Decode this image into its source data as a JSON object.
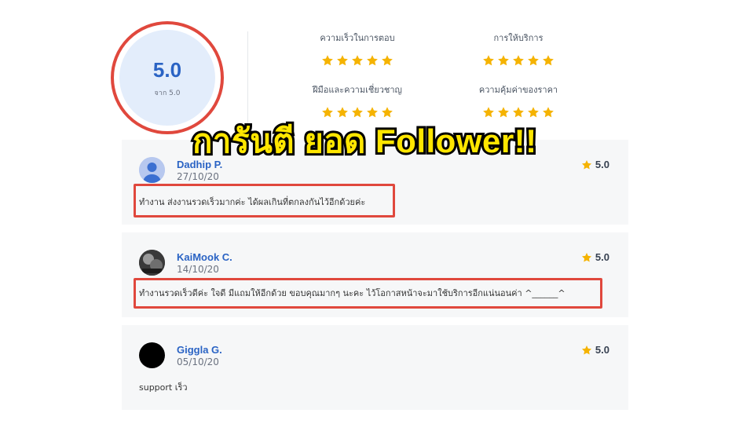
{
  "summary": {
    "score": "5.0",
    "score_caption": "จาก 5.0"
  },
  "categories": [
    {
      "label": "ความเร็วในการตอบ",
      "stars": 5
    },
    {
      "label": "การให้บริการ",
      "stars": 5
    },
    {
      "label": "ฝีมือและความเชี่ยวชาญ",
      "stars": 5
    },
    {
      "label": "ความคุ้มค่าของราคา",
      "stars": 5
    }
  ],
  "headline": "การันตี ยอด Follower!!",
  "reviews": [
    {
      "name": "Dadhip P.",
      "date": "27/10/20",
      "rating": "5.0",
      "text": "ทำงาน ส่งงานรวดเร็วมากค่ะ ได้ผลเกินที่ตกลงกันไว้อีกด้วยค่ะ",
      "avatar": "person-avatar"
    },
    {
      "name": "KaiMook C.",
      "date": "14/10/20",
      "rating": "5.0",
      "text": "ทำงานรวดเร็วดีค่ะ ใจดี มีแถมให้อีกด้วย ขอบคุณมากๆ นะคะ ไว้โอกาสหน้าจะมาใช้บริการอีกแน่นอนค่า ^______^",
      "avatar": "photo-avatar"
    },
    {
      "name": "Giggla G.",
      "date": "05/10/20",
      "rating": "5.0",
      "text": "support เร็ว",
      "avatar": "black-avatar"
    }
  ],
  "colors": {
    "accent": "#2a63c4",
    "star": "#f5b301",
    "highlight": "#e0483d",
    "headline_fill": "#ffe600"
  }
}
